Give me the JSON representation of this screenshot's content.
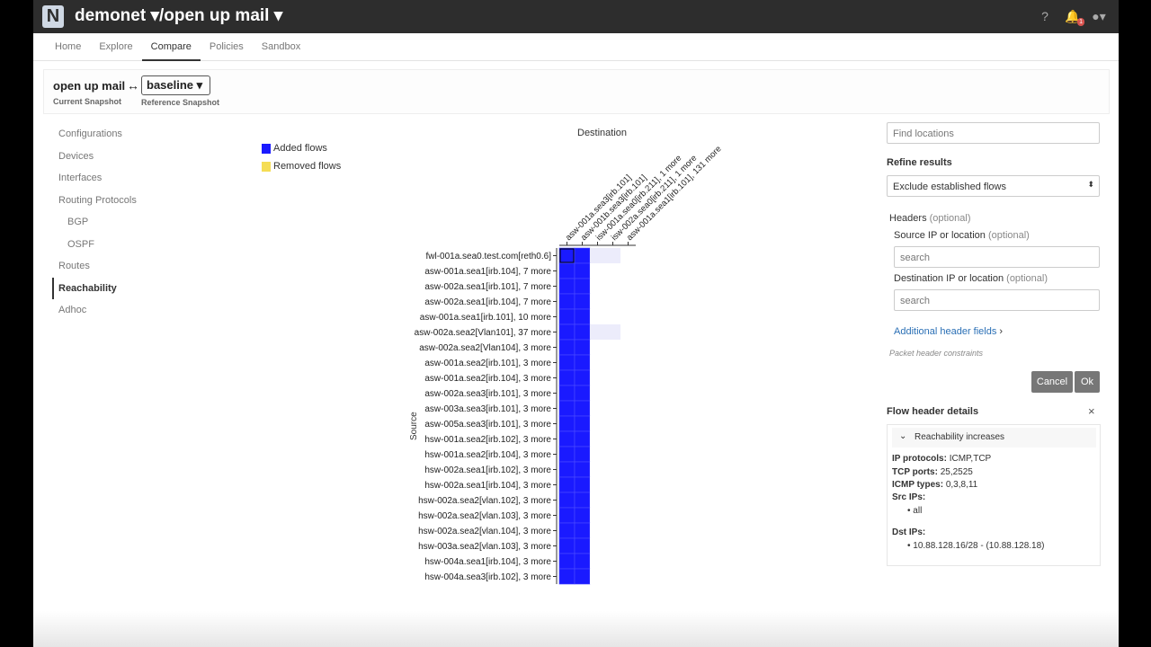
{
  "header": {
    "logo": "N",
    "tenant_title": "demonet ▾/open up mail ▾",
    "notification_count": "1",
    "icons": [
      "help-icon",
      "bell-icon",
      "user-icon"
    ]
  },
  "nav": {
    "tabs": [
      {
        "label": "Home"
      },
      {
        "label": "Explore"
      },
      {
        "label": "Compare",
        "active": true
      },
      {
        "label": "Policies"
      },
      {
        "label": "Sandbox"
      }
    ]
  },
  "snapshots": {
    "current_name": "open up mail",
    "arrow": "↔",
    "current_label": "Current Snapshot",
    "reference_value": "baseline",
    "reference_label": "Reference Snapshot"
  },
  "sidebar": {
    "items": [
      {
        "label": "Configurations"
      },
      {
        "label": "Devices"
      },
      {
        "label": "Interfaces"
      },
      {
        "label": "Routing Protocols"
      },
      {
        "label": "BGP",
        "sub": true
      },
      {
        "label": "OSPF",
        "sub": true
      },
      {
        "label": "Routes"
      },
      {
        "label": "Reachability",
        "active": true
      },
      {
        "label": "Adhoc"
      }
    ]
  },
  "matrix": {
    "legend": [
      {
        "label": "Added flows",
        "color": "#1a1aff"
      },
      {
        "label": "Removed flows",
        "color": "#f5dd55"
      }
    ],
    "destination_title": "Destination",
    "source_title": "Source",
    "columns": [
      "asw-001a.sea3[irb.101]",
      "asw-001b.sea3[irb.101]",
      "isw-001a.sea0[irb.211], 1 more",
      "isw-002a.sea0[irb.211], 1 more",
      "asw-001a.sea1[irb.101], 131 more"
    ],
    "rows": [
      "fwl-001a.sea0.test.com[reth0.6]",
      "asw-001a.sea1[irb.104], 7 more",
      "asw-002a.sea1[irb.101], 7 more",
      "asw-002a.sea1[irb.104], 7 more",
      "asw-001a.sea1[irb.101], 10 more",
      "asw-002a.sea2[Vlan101], 37 more",
      "asw-002a.sea2[Vlan104], 3 more",
      "asw-001a.sea2[irb.101], 3 more",
      "asw-001a.sea2[irb.104], 3 more",
      "asw-002a.sea3[irb.101], 3 more",
      "asw-003a.sea3[irb.101], 3 more",
      "asw-005a.sea3[irb.101], 3 more",
      "hsw-001a.sea2[irb.102], 3 more",
      "hsw-001a.sea2[irb.104], 3 more",
      "hsw-002a.sea1[irb.102], 3 more",
      "hsw-002a.sea1[irb.104], 3 more",
      "hsw-002a.sea2[vlan.102], 3 more",
      "hsw-002a.sea2[vlan.103], 3 more",
      "hsw-002a.sea2[vlan.104], 3 more",
      "hsw-003a.sea2[vlan.103], 3 more",
      "hsw-004a.sea1[irb.104], 3 more",
      "hsw-004a.sea3[irb.102], 3 more"
    ],
    "cells": [
      [
        1,
        1,
        0,
        0,
        0
      ],
      [
        1,
        1,
        0,
        0,
        0
      ],
      [
        1,
        1,
        0,
        0,
        0
      ],
      [
        1,
        1,
        0,
        0,
        0
      ],
      [
        1,
        1,
        0,
        0,
        0
      ],
      [
        1,
        1,
        0,
        0,
        0
      ],
      [
        1,
        1,
        0,
        0,
        0
      ],
      [
        1,
        1,
        0,
        0,
        0
      ],
      [
        1,
        1,
        0,
        0,
        0
      ],
      [
        1,
        1,
        0,
        0,
        0
      ],
      [
        1,
        1,
        0,
        0,
        0
      ],
      [
        1,
        1,
        0,
        0,
        0
      ],
      [
        1,
        1,
        0,
        0,
        0
      ],
      [
        1,
        1,
        0,
        0,
        0
      ],
      [
        1,
        1,
        0,
        0,
        0
      ],
      [
        1,
        1,
        0,
        0,
        0
      ],
      [
        1,
        1,
        0,
        0,
        0
      ],
      [
        1,
        1,
        0,
        0,
        0
      ],
      [
        1,
        1,
        0,
        0,
        0
      ],
      [
        1,
        1,
        0,
        0,
        0
      ],
      [
        1,
        1,
        0,
        0,
        0
      ],
      [
        1,
        1,
        0,
        0,
        0
      ]
    ]
  },
  "filters": {
    "find_placeholder": "Find locations",
    "refine_title": "Refine results",
    "refine_value": "Exclude established flows",
    "headers_label": "Headers",
    "optional": "(optional)",
    "src_label": "Source IP or location",
    "src_placeholder": "search",
    "dst_label": "Destination IP or location",
    "dst_placeholder": "search",
    "additional_link": "Additional header fields",
    "constraints_note": "Packet header constraints",
    "cancel": "Cancel",
    "ok": "Ok"
  },
  "flow_details": {
    "title": "Flow header details",
    "close": "×",
    "section": "Reachability increases",
    "ip_protocols_label": "IP protocols:",
    "ip_protocols": "ICMP,TCP",
    "tcp_ports_label": "TCP ports:",
    "tcp_ports": "25,2525",
    "icmp_types_label": "ICMP types:",
    "icmp_types": "0,3,8,11",
    "src_ips_label": "Src IPs:",
    "src_ips": "all",
    "dst_ips_label": "Dst IPs:",
    "dst_ips": "10.88.128.16/28 - (10.88.128.18)"
  }
}
